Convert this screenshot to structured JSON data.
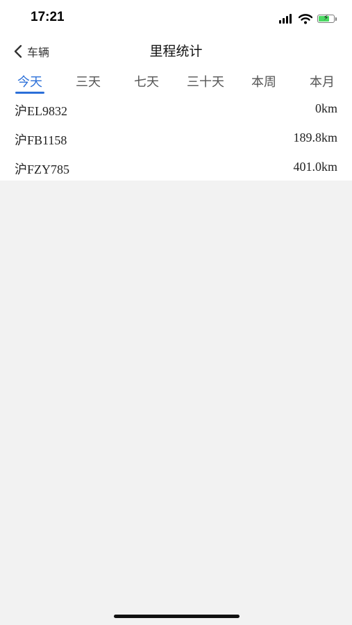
{
  "status_bar": {
    "time": "17:21",
    "icons": [
      "signal-icon",
      "wifi-icon",
      "battery-charging-icon"
    ],
    "battery_level": 0.75
  },
  "nav": {
    "back_label": "车辆",
    "title": "里程统计"
  },
  "tabs": [
    {
      "label": "今天",
      "active": true
    },
    {
      "label": "三天",
      "active": false
    },
    {
      "label": "七天",
      "active": false
    },
    {
      "label": "三十天",
      "active": false
    },
    {
      "label": "本周",
      "active": false
    },
    {
      "label": "本月",
      "active": false
    }
  ],
  "vehicles": [
    {
      "plate": "沪EL9832",
      "mileage": "0km"
    },
    {
      "plate": "沪FB1158",
      "mileage": "189.8km"
    },
    {
      "plate": "沪FZY785",
      "mileage": "401.0km"
    }
  ],
  "colors": {
    "accent": "#2b6fd8",
    "background": "#f2f2f2",
    "surface": "#ffffff",
    "battery": "#4cd964"
  }
}
